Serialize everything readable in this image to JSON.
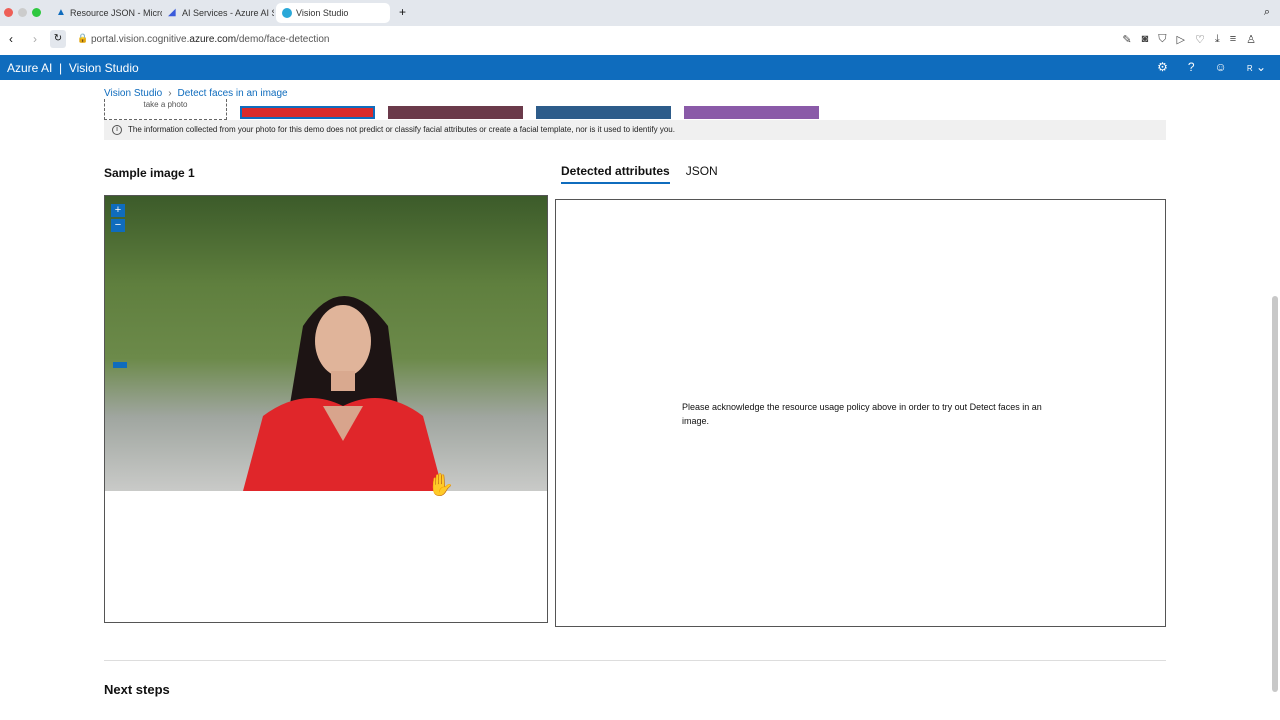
{
  "browser": {
    "tabs": [
      {
        "label": "Resource JSON - Microsoft Azure"
      },
      {
        "label": "AI Services - Azure AI Studio"
      },
      {
        "label": "Vision Studio"
      }
    ],
    "url_prefix": "portal.vision.cognitive.",
    "url_domain": "azure.com",
    "url_path": "/demo/face-detection"
  },
  "header": {
    "brand": "Azure AI",
    "separator": "|",
    "app": "Vision Studio",
    "user_initial": "R"
  },
  "breadcrumb": {
    "root": "Vision Studio",
    "separator": "›",
    "current": "Detect faces in an image"
  },
  "take_photo": "take a photo",
  "info_notice": "The information collected from your photo for this demo does not predict or classify facial attributes or create a facial template, nor is it used to identify you.",
  "sample": {
    "title": "Sample image 1",
    "zoom_in": "+",
    "zoom_out": "−"
  },
  "result_tabs": [
    {
      "label": "Detected attributes"
    },
    {
      "label": "JSON"
    }
  ],
  "result_message": "Please acknowledge the resource usage policy above in order to try out Detect faces in an image.",
  "next_steps": "Next steps"
}
